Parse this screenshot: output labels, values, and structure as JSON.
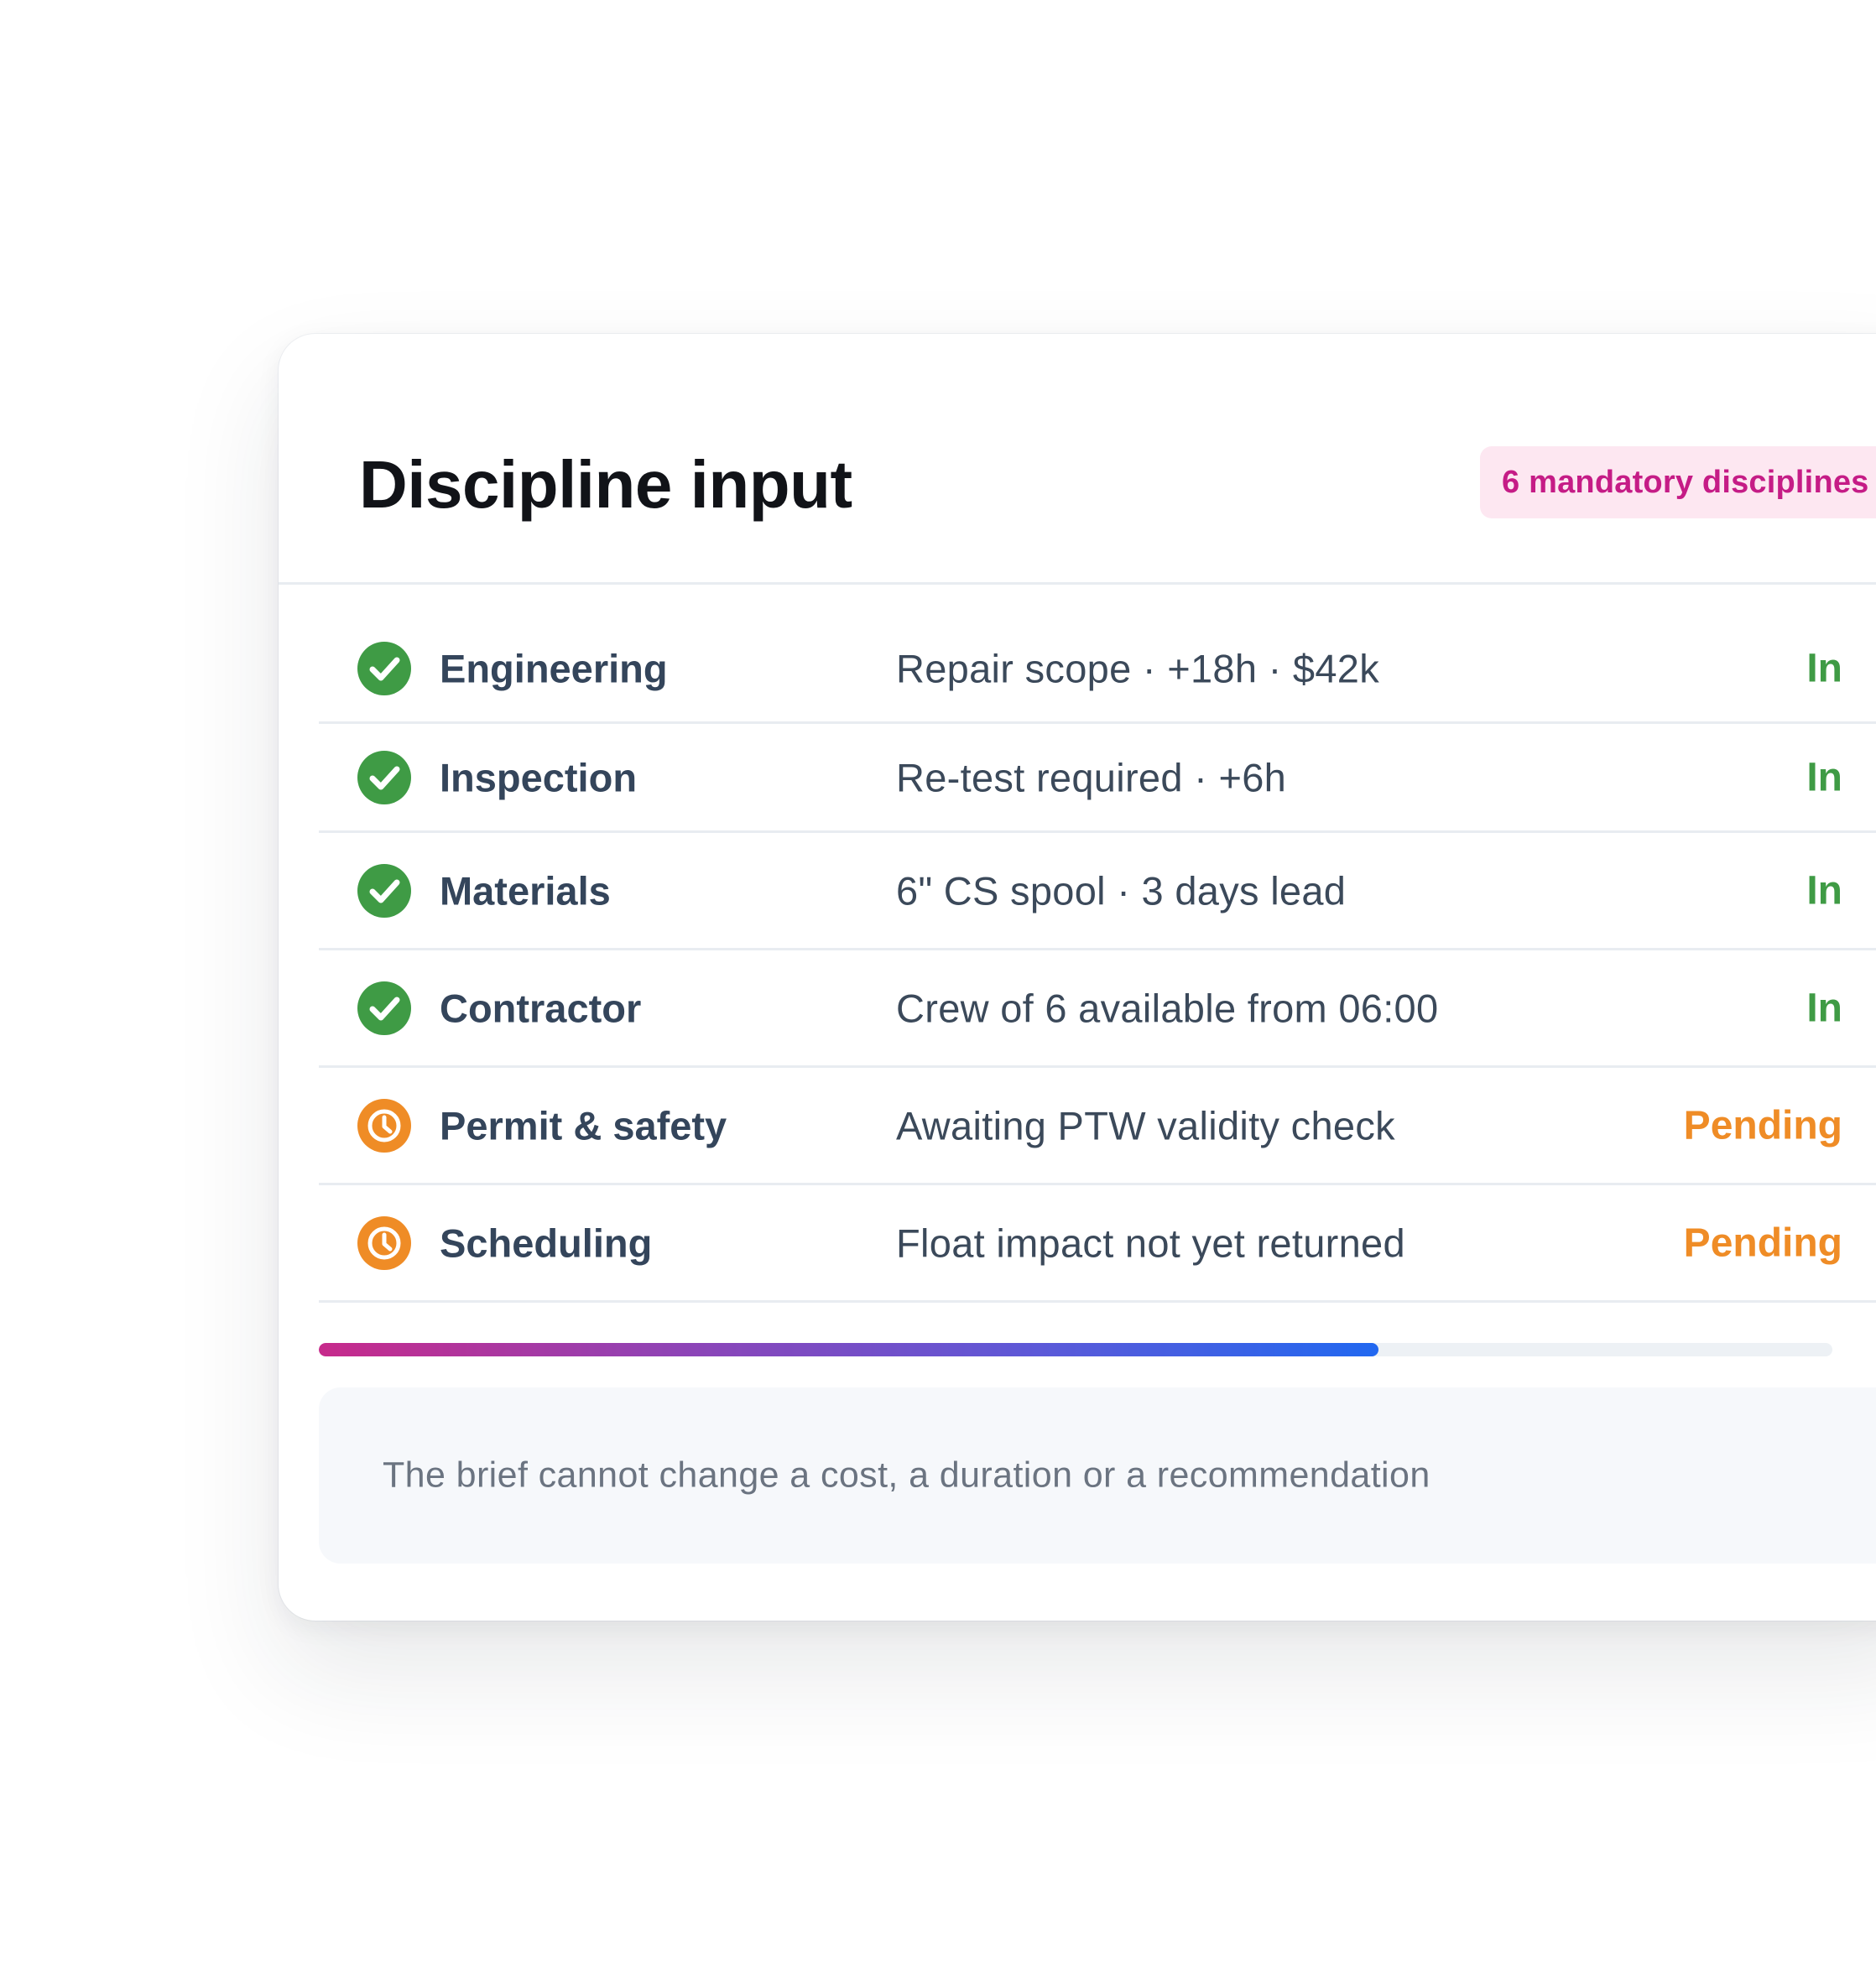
{
  "panel": {
    "title": "Discipline input",
    "badge": "6 mandatory disciplines"
  },
  "disciplines": [
    {
      "name": "Engineering",
      "detail": "Repair scope · +18h · $42k",
      "status": "In",
      "status_icon": "check-circle-icon"
    },
    {
      "name": "Inspection",
      "detail": "Re-test required · +6h",
      "status": "In",
      "status_icon": "check-circle-icon"
    },
    {
      "name": "Materials",
      "detail": "6\" CS spool · 3 days lead",
      "status": "In",
      "status_icon": "check-circle-icon"
    },
    {
      "name": "Contractor",
      "detail": "Crew of 6 available from 06:00",
      "status": "In",
      "status_icon": "check-circle-icon"
    },
    {
      "name": "Permit & safety",
      "detail": "Awaiting PTW validity check",
      "status": "Pending",
      "status_icon": "clock-icon"
    },
    {
      "name": "Scheduling",
      "detail": "Float impact not yet returned",
      "status": "Pending",
      "status_icon": "clock-icon"
    }
  ],
  "progress": {
    "fraction": 0.7
  },
  "note": {
    "text": "The brief cannot change a cost, a duration or a recommendation"
  },
  "colors": {
    "status_in": "#3f9b45",
    "status_pending": "#ef8c26",
    "badge_background": "#fde7f1",
    "badge_text": "#c51c86",
    "progress_start": "#c72a8b",
    "progress_end": "#2168f0"
  }
}
